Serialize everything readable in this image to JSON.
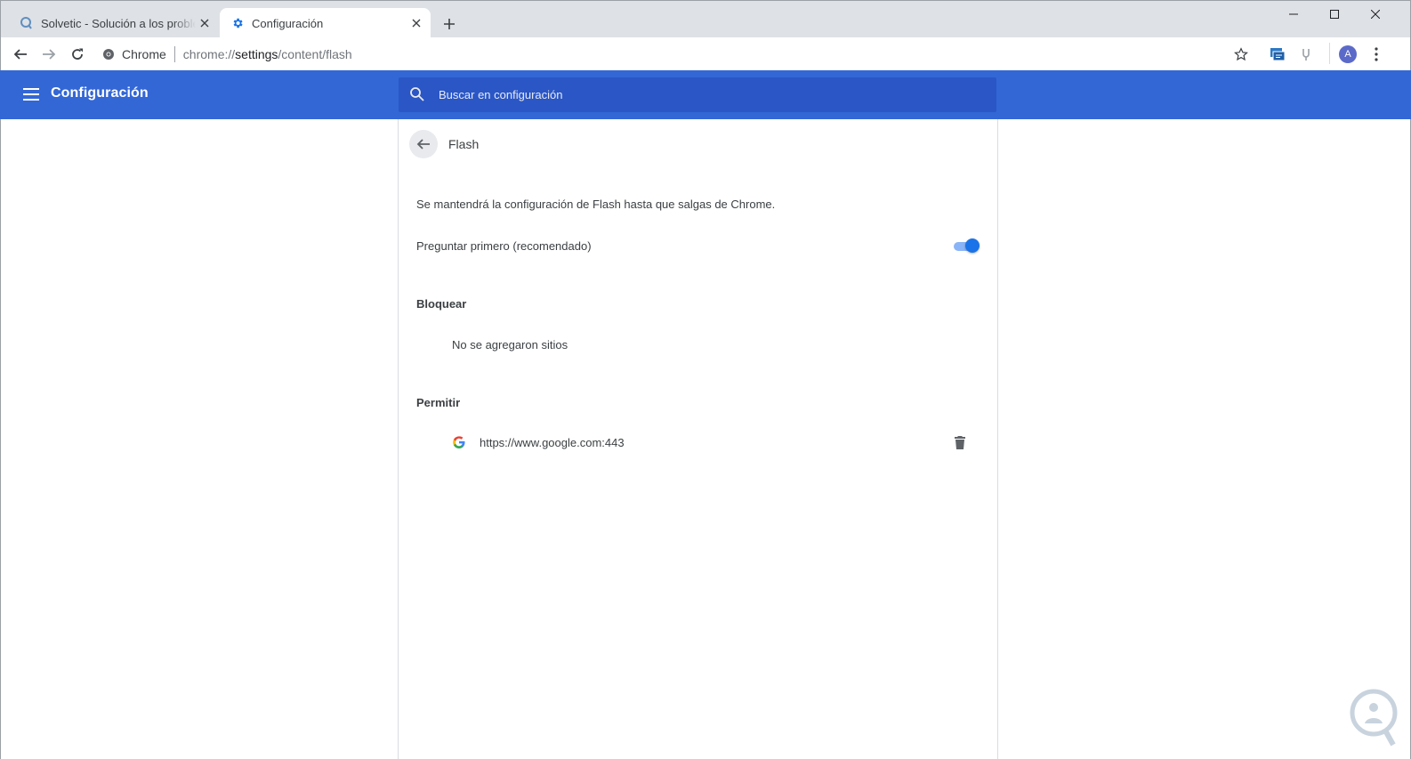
{
  "tabs": [
    {
      "title": "Solvetic - Solución a los problem",
      "active": false,
      "icon": "solvetic-favicon"
    },
    {
      "title": "Configuración",
      "active": true,
      "icon": "gear-icon"
    }
  ],
  "toolbar": {
    "site_chip": "Chrome",
    "url_scheme": "chrome://",
    "url_host": "settings",
    "url_path": "/content/flash",
    "avatar_letter": "A"
  },
  "header": {
    "title": "Configuración",
    "search_placeholder": "Buscar en configuración"
  },
  "subpage": {
    "title": "Flash",
    "note": "Se mantendrá la configuración de Flash hasta que salgas de Chrome.",
    "ask_first_label": "Preguntar primero (recomendado)",
    "ask_first_enabled": true,
    "block_heading": "Bloquear",
    "block_empty": "No se agregaron sitios",
    "allow_heading": "Permitir",
    "allow_sites": [
      {
        "url": "https://www.google.com:443",
        "icon": "google-favicon"
      }
    ]
  },
  "colors": {
    "header_bg": "#3367d6",
    "search_bg": "#2a56c6",
    "toggle_on": "#1a73e8",
    "tabstrip_bg": "#dee1e6"
  }
}
